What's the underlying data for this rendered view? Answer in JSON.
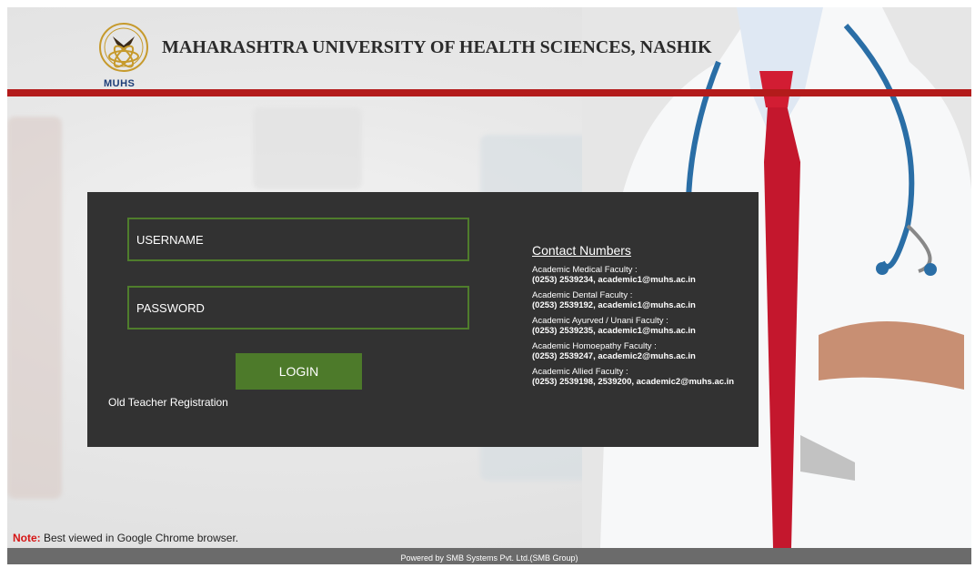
{
  "header": {
    "logo_text": "MUHS",
    "title": "MAHARASHTRA UNIVERSITY OF HEALTH SCIENCES, NASHIK"
  },
  "login": {
    "username_placeholder": "USERNAME",
    "password_placeholder": "PASSWORD",
    "login_label": "LOGIN",
    "old_teacher_label": "Old Teacher Registration"
  },
  "contacts": {
    "heading": "Contact Numbers",
    "items": [
      {
        "label": "Academic Medical Faculty :",
        "detail": "(0253) 2539234, academic1@muhs.ac.in"
      },
      {
        "label": "Academic Dental Faculty :",
        "detail": "(0253) 2539192, academic1@muhs.ac.in"
      },
      {
        "label": "Academic Ayurved / Unani Faculty :",
        "detail": "(0253) 2539235, academic1@muhs.ac.in"
      },
      {
        "label": "Academic Homoepathy Faculty :",
        "detail": "(0253) 2539247, academic2@muhs.ac.in"
      },
      {
        "label": "Academic Allied Faculty :",
        "detail": "(0253) 2539198, 2539200, academic2@muhs.ac.in"
      }
    ]
  },
  "note": {
    "label": "Note:",
    "text": " Best viewed in Google Chrome browser."
  },
  "footer": {
    "text": "Powered by SMB Systems Pvt. Ltd.(SMB Group)"
  },
  "colors": {
    "red_bar": "#b31b1b",
    "panel": "#323232",
    "accent_green": "#4d7a2a"
  }
}
